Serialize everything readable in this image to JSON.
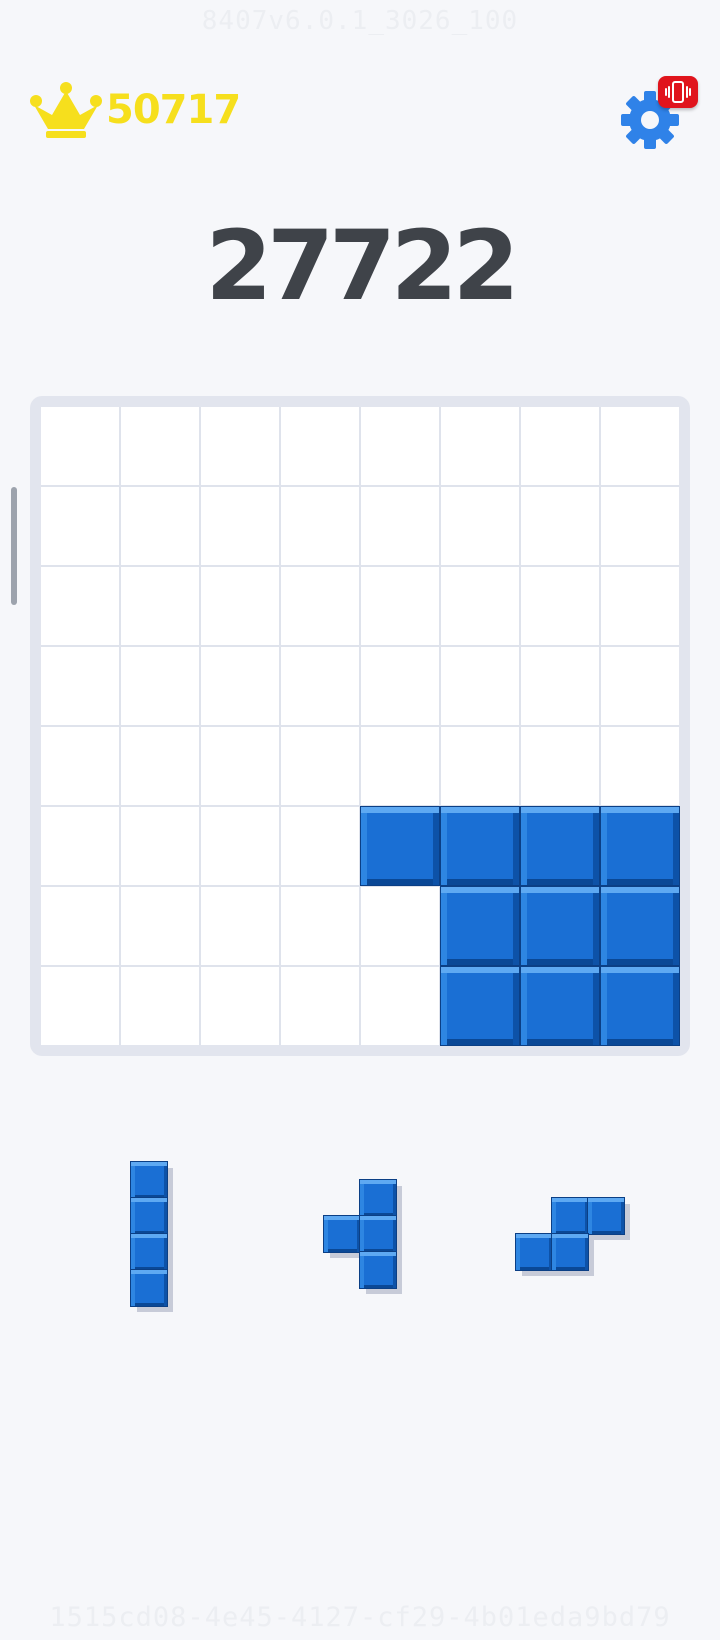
{
  "watermark_top": "8407v6.0.1_3026_100",
  "watermark_bottom": "1515cd08-4e45-4127-cf29-4b01eda9bd79",
  "header": {
    "best_score": "50717",
    "crown_icon": "crown-icon",
    "settings_icon": "gear-icon",
    "vibration_icon": "vibrate-icon"
  },
  "score": "27722",
  "colors": {
    "block": "#1a6fd4",
    "best_score": "#f6df1d",
    "score": "#3f4349",
    "badge": "#e0141c",
    "gear": "#2f82e8"
  },
  "board": {
    "rows": 8,
    "cols": 8,
    "cells": [
      [
        0,
        0,
        0,
        0,
        0,
        0,
        0,
        0
      ],
      [
        0,
        0,
        0,
        0,
        0,
        0,
        0,
        0
      ],
      [
        0,
        0,
        0,
        0,
        0,
        0,
        0,
        0
      ],
      [
        0,
        0,
        0,
        0,
        0,
        0,
        0,
        0
      ],
      [
        0,
        0,
        0,
        0,
        0,
        0,
        0,
        0
      ],
      [
        0,
        0,
        0,
        0,
        1,
        1,
        1,
        1
      ],
      [
        0,
        0,
        0,
        0,
        0,
        1,
        1,
        1
      ],
      [
        0,
        0,
        0,
        0,
        0,
        1,
        1,
        1
      ]
    ]
  },
  "pieces": [
    {
      "name": "I-vertical-4",
      "shape": [
        [
          1
        ],
        [
          1
        ],
        [
          1
        ],
        [
          1
        ]
      ]
    },
    {
      "name": "T-left",
      "shape": [
        [
          0,
          1
        ],
        [
          1,
          1
        ],
        [
          0,
          1
        ]
      ]
    },
    {
      "name": "S-horizontal",
      "shape": [
        [
          0,
          1,
          1
        ],
        [
          1,
          1,
          0
        ]
      ]
    }
  ]
}
